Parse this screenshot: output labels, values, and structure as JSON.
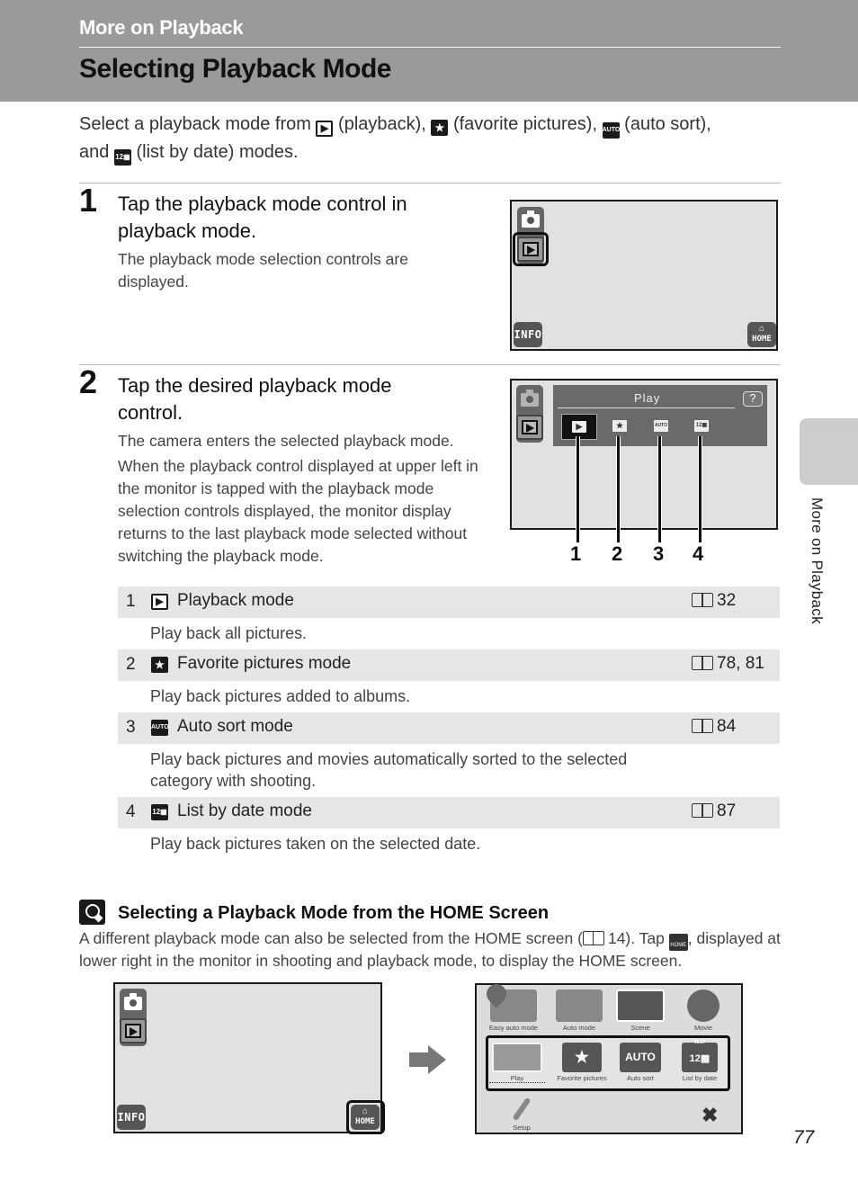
{
  "header": {
    "section": "More on Playback",
    "title": "Selecting Playback Mode"
  },
  "intro": {
    "part1": "Select a playback mode from",
    "play_label": "(playback),",
    "fav_label": "(favorite pictures),",
    "auto_label": "(auto sort),",
    "part2": "and",
    "date_label": "(list by date) modes."
  },
  "icons": {
    "playback": "▶",
    "favorite": "★",
    "auto_sort": "AUTO",
    "list_by_date": "12▦"
  },
  "steps": [
    {
      "number": "1",
      "title": "Tap the playback mode control in playback mode.",
      "body": "The playback mode selection controls are displayed."
    },
    {
      "number": "2",
      "title": "Tap the desired playback mode control.",
      "body1": "The camera enters the selected playback mode.",
      "body2": "When the playback control displayed at upper left in the monitor is tapped with the playback mode selection controls displayed, the monitor display returns to the last playback mode selected without switching the playback mode."
    }
  ],
  "monitor1": {
    "info_label": "INFO",
    "home_label": "HOME"
  },
  "monitor2": {
    "panel_title": "Play",
    "help_label": "?",
    "mode_icons": [
      "▶",
      "★",
      "AUTO",
      "12▦"
    ],
    "callouts": [
      "1",
      "2",
      "3",
      "4"
    ]
  },
  "modes_table": [
    {
      "num": "1",
      "icon": "▶",
      "label": "Playback mode",
      "ref": "32",
      "desc": "Play back all pictures."
    },
    {
      "num": "2",
      "icon": "★",
      "label": "Favorite pictures mode",
      "ref": "78, 81",
      "desc": "Play back pictures added to albums."
    },
    {
      "num": "3",
      "icon": "AUTO",
      "label": "Auto sort mode",
      "ref": "84",
      "desc": "Play back pictures and movies automatically sorted to the selected category with shooting."
    },
    {
      "num": "4",
      "icon": "12▦",
      "label": "List by date mode",
      "ref": "87",
      "desc": "Play back pictures taken on the selected date."
    }
  ],
  "tip": {
    "title": "Selecting a Playback Mode from the HOME Screen",
    "body_part1": "A different playback mode can also be selected from the HOME screen (",
    "body_ref": "14). Tap",
    "body_part2": ", displayed at lower right in the monitor in shooting and playback mode, to display the HOME screen."
  },
  "monitor3": {
    "info_label": "INFO",
    "home_label": "HOME"
  },
  "home_screen": {
    "top_row": [
      "Easy auto mode",
      "Auto mode",
      "Scene",
      "Movie"
    ],
    "playback_row": [
      {
        "label": "Play"
      },
      {
        "label": "Favorite pictures",
        "icon": "★"
      },
      {
        "label": "Auto sort",
        "icon": "AUTO"
      },
      {
        "label": "List by date",
        "icon": "12▦",
        "date_tag": "08.17"
      }
    ],
    "setup_label": "Setup",
    "close_icon": "✖"
  },
  "side_tab": {
    "label": "More on Playback"
  },
  "page_number": "77"
}
